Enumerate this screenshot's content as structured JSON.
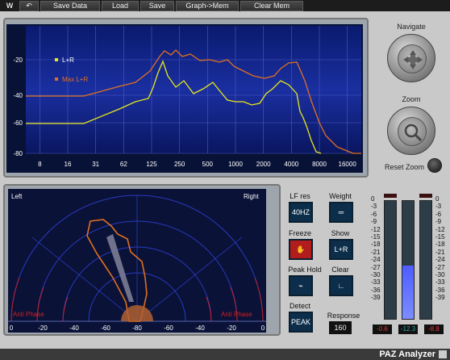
{
  "toolbar": {
    "logo_icon": "waves-logo-icon",
    "undo_icon": "undo-icon",
    "save_data": "Save Data",
    "load": "Load",
    "save": "Save",
    "graph_to_mem": "Graph->Mem",
    "clear_mem": "Clear Mem"
  },
  "spectrum": {
    "legend": [
      {
        "label": "L+R",
        "color": "#e8e81a"
      },
      {
        "label": "Max L+R",
        "color": "#e07020"
      }
    ],
    "y_ticks": [
      "-20",
      "-40",
      "-60",
      "-80"
    ],
    "x_ticks": [
      "8",
      "16",
      "31",
      "62",
      "125",
      "250",
      "500",
      "1000",
      "2000",
      "4000",
      "8000",
      "16000"
    ]
  },
  "navigation": {
    "navigate_label": "Navigate",
    "zoom_label": "Zoom",
    "reset_zoom_label": "Reset Zoom"
  },
  "stereo": {
    "left_label": "Left",
    "right_label": "Right",
    "anti_phase_left": "Anti Phase",
    "anti_phase_right": "Anti Phase",
    "scale": [
      "0",
      "-20",
      "-40",
      "-60",
      "-80",
      "-60",
      "-40",
      "-20",
      "0"
    ]
  },
  "controls": {
    "lf_res_label": "LF res",
    "lf_res_value": "40HZ",
    "weight_label": "Weight",
    "freeze_label": "Freeze",
    "show_label": "Show",
    "show_value": "L+R",
    "peak_hold_label": "Peak Hold",
    "clear_label": "Clear",
    "detect_label": "Detect",
    "detect_value": "PEAK",
    "response_label": "Response",
    "response_value": "160"
  },
  "meters": {
    "scale_left": [
      "0",
      "-3",
      "-6",
      "-9",
      "-12",
      "-15",
      "-18",
      "-21",
      "-24",
      "-27",
      "-30",
      "-33",
      "-36",
      "-39"
    ],
    "scale_right": [
      "0",
      "-3",
      "-6",
      "-9",
      "-12",
      "-15",
      "-18",
      "-21",
      "-24",
      "-27",
      "-30",
      "-33",
      "-36",
      "-39"
    ],
    "left_peak": "-0.6",
    "mid_value": "-12.3",
    "right_peak": "-8.8",
    "left_level": 0,
    "center_level": 0.45,
    "right_level": 0
  },
  "footer": {
    "brand": "PAZ Analyzer"
  }
}
